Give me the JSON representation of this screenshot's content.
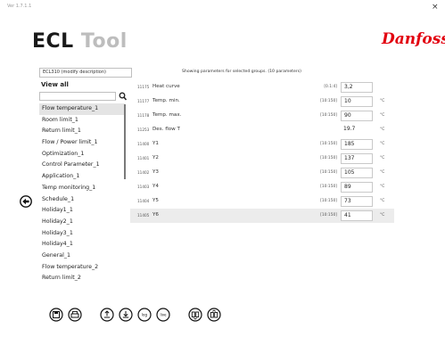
{
  "app": {
    "version": "Ver 1.7.1.1",
    "close_glyph": "×",
    "title_part1": "ECL",
    "title_part2": "Tool",
    "logo_text": "Danfoss",
    "brand_color": "#e2000f"
  },
  "header": {
    "controller_desc": "ECL310 (modify description)",
    "showing_text": "Showing parameters for selected groups. (10 parameters)"
  },
  "sidebar": {
    "view_all_label": "View all",
    "search_value": "",
    "search_icon": "search-icon",
    "groups": [
      "Flow temperature_1",
      "Room limit_1",
      "Return limit_1",
      "Flow / Power limit_1",
      "Optimization_1",
      "Control Parameter_1",
      "Application_1",
      "Temp monitoring_1",
      "Schedule_1",
      "Holiday1_1",
      "Holiday2_1",
      "Holiday3_1",
      "Holiday4_1",
      "General_1",
      "Flow temperature_2",
      "Return limit_2"
    ],
    "selected_index": 0
  },
  "parameters": [
    {
      "id": "11175",
      "name": "Heat curve",
      "range": "[0.1:4]",
      "value": "3,2",
      "unit": ""
    },
    {
      "id": "11177",
      "name": "Temp. min.",
      "range": "[10:150]",
      "value": "10",
      "unit": "°C"
    },
    {
      "id": "11178",
      "name": "Temp. max.",
      "range": "[10:150]",
      "value": "90",
      "unit": "°C"
    },
    {
      "id": "11253",
      "name": "Des. flow T",
      "range": "",
      "value": "19.7",
      "unit": "°C",
      "readonly": true
    },
    {
      "id": "11400",
      "name": "Y1",
      "range": "[10:150]",
      "value": "185",
      "unit": "°C"
    },
    {
      "id": "11401",
      "name": "Y2",
      "range": "[10:150]",
      "value": "137",
      "unit": "°C"
    },
    {
      "id": "11402",
      "name": "Y3",
      "range": "[10:150]",
      "value": "105",
      "unit": "°C"
    },
    {
      "id": "11403",
      "name": "Y4",
      "range": "[10:150]",
      "value": "89",
      "unit": "°C"
    },
    {
      "id": "11404",
      "name": "Y5",
      "range": "[10:150]",
      "value": "73",
      "unit": "°C"
    },
    {
      "id": "11405",
      "name": "Y6",
      "range": "[10:150]",
      "value": "41",
      "unit": "°C"
    }
  ],
  "toolbar": {
    "log_label": "log",
    "live_label": "live",
    "icons": [
      "save-icon",
      "print-icon",
      "upload-icon",
      "download-icon",
      "log-icon",
      "live-icon",
      "read-controller-icon",
      "write-controller-icon"
    ]
  }
}
